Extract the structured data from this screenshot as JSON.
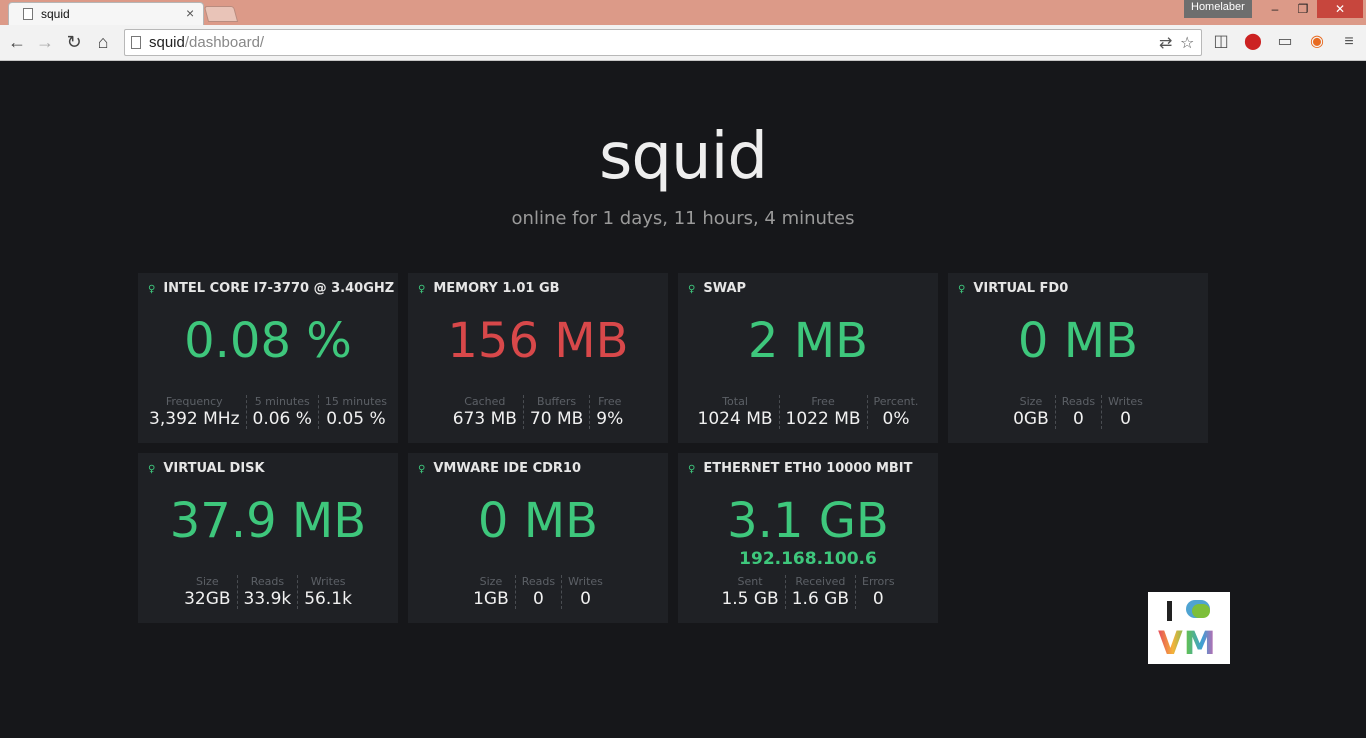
{
  "browser": {
    "tab_title": "squid",
    "profile_name": "Homelaber",
    "url_host": "squid",
    "url_path": "/dashboard/"
  },
  "page": {
    "hostname": "squid",
    "uptime": "online for 1 days, 11 hours, 4 minutes"
  },
  "colors": {
    "good": "#3ec77c",
    "warn": "#d8484a",
    "background": "#16171a",
    "card": "#1f2125"
  },
  "cards": [
    {
      "title": "INTEL CORE I7-3770 @ 3.40GHZ",
      "value": "0.08 %",
      "status": "good",
      "stats": [
        {
          "label": "Frequency",
          "value": "3,392 MHz"
        },
        {
          "label": "5 minutes",
          "value": "0.06 %"
        },
        {
          "label": "15 minutes",
          "value": "0.05 %"
        }
      ]
    },
    {
      "title": "MEMORY 1.01 GB",
      "value": "156 MB",
      "status": "warn",
      "stats": [
        {
          "label": "Cached",
          "value": "673 MB"
        },
        {
          "label": "Buffers",
          "value": "70 MB"
        },
        {
          "label": "Free",
          "value": "9%"
        }
      ]
    },
    {
      "title": "SWAP",
      "value": "2 MB",
      "status": "good",
      "stats": [
        {
          "label": "Total",
          "value": "1024 MB"
        },
        {
          "label": "Free",
          "value": "1022 MB"
        },
        {
          "label": "Percent.",
          "value": "0%"
        }
      ]
    },
    {
      "title": "VIRTUAL FD0",
      "value": "0 MB",
      "status": "good",
      "stats": [
        {
          "label": "Size",
          "value": "0GB"
        },
        {
          "label": "Reads",
          "value": "0"
        },
        {
          "label": "Writes",
          "value": "0"
        }
      ]
    },
    {
      "title": "VIRTUAL DISK",
      "value": "37.9 MB",
      "status": "good",
      "stats": [
        {
          "label": "Size",
          "value": "32GB"
        },
        {
          "label": "Reads",
          "value": "33.9k"
        },
        {
          "label": "Writes",
          "value": "56.1k"
        }
      ]
    },
    {
      "title": "VMWARE IDE CDR10",
      "value": "0 MB",
      "status": "good",
      "stats": [
        {
          "label": "Size",
          "value": "1GB"
        },
        {
          "label": "Reads",
          "value": "0"
        },
        {
          "label": "Writes",
          "value": "0"
        }
      ]
    },
    {
      "title": "ETHERNET ETH0 10000 MBIT",
      "value": "3.1 GB",
      "subvalue": "192.168.100.6",
      "status": "good",
      "stats": [
        {
          "label": "Sent",
          "value": "1.5 GB"
        },
        {
          "label": "Received",
          "value": "1.6 GB"
        },
        {
          "label": "Errors",
          "value": "0"
        }
      ]
    }
  ],
  "logo": {
    "text": "I VM"
  }
}
